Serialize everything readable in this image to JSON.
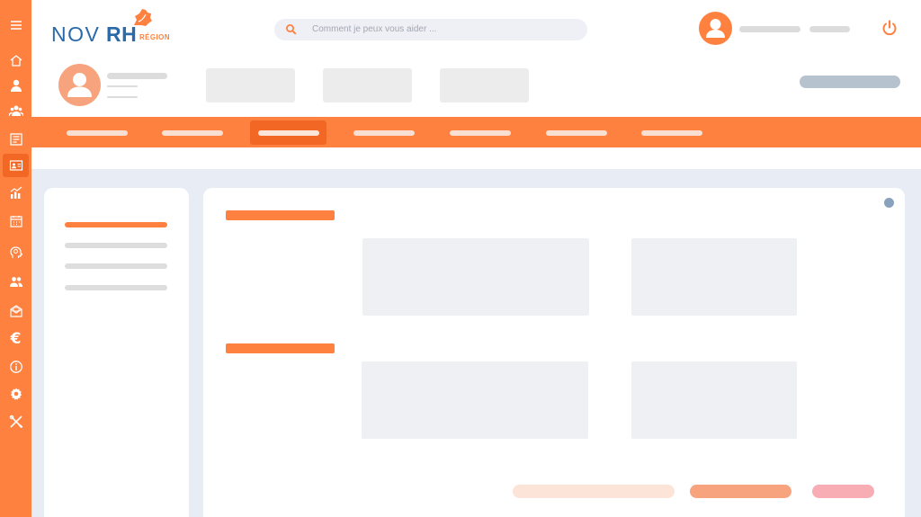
{
  "app": {
    "brand_nov": "NOV",
    "brand_rh": "RH",
    "brand_region": "RÉGION"
  },
  "header": {
    "search_placeholder": "Comment je peux vous aider ..."
  },
  "sidebar": {
    "items": [
      {
        "icon": "menu-icon"
      },
      {
        "icon": "home-icon"
      },
      {
        "icon": "user-icon"
      },
      {
        "icon": "group-icon"
      },
      {
        "icon": "document-icon"
      },
      {
        "icon": "id-card-icon",
        "active": true
      },
      {
        "icon": "chart-icon"
      },
      {
        "icon": "calendar-icon"
      },
      {
        "icon": "brain-icon"
      },
      {
        "icon": "team-icon"
      },
      {
        "icon": "mail-icon"
      },
      {
        "icon": "euro-icon",
        "glyph": "€"
      },
      {
        "icon": "info-icon"
      },
      {
        "icon": "gear-icon"
      },
      {
        "icon": "tools-icon"
      }
    ]
  },
  "nav": {
    "active_index": 2,
    "tab_count": 7
  },
  "colors": {
    "accent": "#ff813f",
    "accent_dark": "#f26724",
    "brand_blue": "#2a6aa8",
    "background": "#e8ecf5"
  }
}
